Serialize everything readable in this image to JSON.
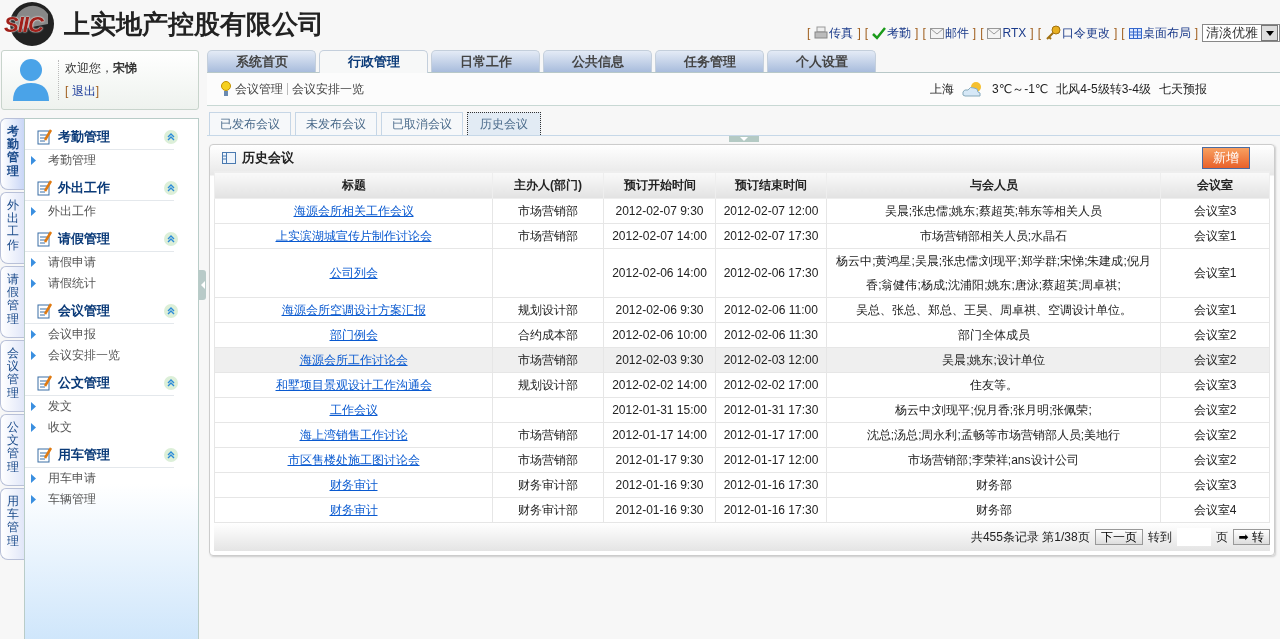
{
  "header": {
    "company": "上实地产控股有限公司",
    "logo_text": "SIIC",
    "links": [
      {
        "open": "[",
        "label": "传真",
        "close": "]"
      },
      {
        "open": "[",
        "label": "考勤",
        "close": "]"
      },
      {
        "open": "[",
        "label": "邮件",
        "close": "]"
      },
      {
        "open": "[",
        "label": "RTX",
        "close": "]"
      },
      {
        "open": "[",
        "label": "口令更改",
        "close": "]"
      },
      {
        "open": "[",
        "label": "桌面布局",
        "close": "]"
      }
    ],
    "theme_select": "清淡优雅"
  },
  "user": {
    "greeting": "欢迎您，",
    "name": "宋悌",
    "logout": "退出",
    "open": "[",
    "close": "]"
  },
  "tabs": [
    {
      "label": "系统首页",
      "selected": false
    },
    {
      "label": "行政管理",
      "selected": true
    },
    {
      "label": "日常工作",
      "selected": false
    },
    {
      "label": "公共信息",
      "selected": false
    },
    {
      "label": "任务管理",
      "selected": false
    },
    {
      "label": "个人设置",
      "selected": false
    }
  ],
  "breadcrumb": [
    "会议管理",
    "会议安排一览"
  ],
  "weather": {
    "city": "上海",
    "temperature": "3℃～-1℃",
    "wind": "北风4-5级转3-4级",
    "forecast": "七天预报"
  },
  "side_tabs": [
    {
      "label": "考勤管理",
      "selected": true
    },
    {
      "label": "外出工作",
      "selected": false
    },
    {
      "label": "请假管理",
      "selected": false
    },
    {
      "label": "会议管理",
      "selected": false
    },
    {
      "label": "公文管理",
      "selected": false
    },
    {
      "label": "用车管理",
      "selected": false
    }
  ],
  "menu": [
    {
      "title": "考勤管理",
      "expanded": true,
      "items": [
        "考勤管理"
      ]
    },
    {
      "title": "外出工作",
      "expanded": true,
      "items": [
        "外出工作"
      ]
    },
    {
      "title": "请假管理",
      "expanded": true,
      "items": [
        "请假申请",
        "请假统计"
      ]
    },
    {
      "title": "会议管理",
      "expanded": true,
      "items": [
        "会议申报",
        "会议安排一览"
      ]
    },
    {
      "title": "公文管理",
      "expanded": true,
      "items": [
        "发文",
        "收文"
      ]
    },
    {
      "title": "用车管理",
      "expanded": true,
      "items": [
        "用车申请",
        "车辆管理"
      ]
    }
  ],
  "sub_tabs": [
    {
      "label": "已发布会议",
      "selected": false
    },
    {
      "label": "未发布会议",
      "selected": false
    },
    {
      "label": "已取消会议",
      "selected": false
    },
    {
      "label": "历史会议",
      "selected": true
    }
  ],
  "panel": {
    "title": "历史会议",
    "add_button": "新增"
  },
  "table": {
    "columns": [
      "标题",
      "主办人(部门)",
      "预订开始时间",
      "预订结束时间",
      "与会人员",
      "会议室"
    ],
    "rows": [
      {
        "selected": false,
        "cells": [
          "海源会所相关工作会议",
          "市场营销部",
          "2012-02-07 9:30",
          "2012-02-07 12:00",
          "吴晨;张忠儒;姚东;蔡超英;韩东等相关人员",
          "会议室3"
        ]
      },
      {
        "selected": false,
        "cells": [
          "上实滨湖城宣传片制作讨论会",
          "市场营销部",
          "2012-02-07 14:00",
          "2012-02-07 17:30",
          "市场营销部相关人员;水晶石",
          "会议室1"
        ]
      },
      {
        "selected": false,
        "cells": [
          "公司列会",
          "",
          "2012-02-06 14:00",
          "2012-02-06 17:30",
          "杨云中;黄鸿星;吴晨;张忠儒;刘现平;郑学群;宋悌;朱建成;倪月香;翁健伟;杨成;沈浦阳;姚东;唐泳;蔡超英;周卓祺;",
          "会议室1"
        ]
      },
      {
        "selected": false,
        "cells": [
          "海源会所空调设计方案汇报",
          "规划设计部",
          "2012-02-06 9:30",
          "2012-02-06 11:00",
          "吴总、张总、郑总、王昊、周卓祺、空调设计单位。",
          "会议室1"
        ]
      },
      {
        "selected": false,
        "cells": [
          "部门例会",
          "合约成本部",
          "2012-02-06 10:00",
          "2012-02-06 11:30",
          "部门全体成员",
          "会议室2"
        ]
      },
      {
        "selected": true,
        "cells": [
          "海源会所工作讨论会",
          "市场营销部",
          "2012-02-03 9:30",
          "2012-02-03 12:00",
          "吴晨;姚东;设计单位",
          "会议室2"
        ]
      },
      {
        "selected": false,
        "cells": [
          "和墅项目景观设计工作沟通会",
          "规划设计部",
          "2012-02-02 14:00",
          "2012-02-02 17:00",
          "住友等。",
          "会议室3"
        ]
      },
      {
        "selected": false,
        "cells": [
          "工作会议",
          "",
          "2012-01-31 15:00",
          "2012-01-31 17:30",
          "杨云中;刘现平;倪月香;张月明;张佩荣;",
          "会议室2"
        ]
      },
      {
        "selected": false,
        "cells": [
          "海上湾销售工作讨论",
          "市场营销部",
          "2012-01-17 14:00",
          "2012-01-17 17:00",
          "沈总;汤总;周永利;孟畅等市场营销部人员;美地行",
          "会议室2"
        ]
      },
      {
        "selected": false,
        "cells": [
          "市区售楼处施工图讨论会",
          "市场营销部",
          "2012-01-17 9:30",
          "2012-01-17 12:00",
          "市场营销部;李荣祥;ans设计公司",
          "会议室2"
        ]
      },
      {
        "selected": false,
        "cells": [
          "财务审计",
          "财务审计部",
          "2012-01-16 9:30",
          "2012-01-16 17:30",
          "财务部",
          "会议室3"
        ]
      },
      {
        "selected": false,
        "cells": [
          "财务审计",
          "财务审计部",
          "2012-01-16 9:30",
          "2012-01-16 17:30",
          "财务部",
          "会议室4"
        ]
      }
    ]
  },
  "pagination": {
    "summary": "共455条记录 第1/38页",
    "next": "下一页",
    "goto_label": "转到",
    "page_unit": "页",
    "go_button": "➡ 转"
  }
}
